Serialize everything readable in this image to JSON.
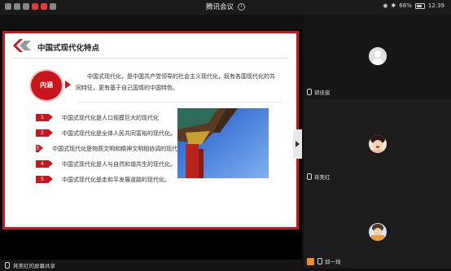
{
  "statusbar": {
    "title": "腾讯会议",
    "battery": "66%",
    "time": "12:39"
  },
  "slide": {
    "title": "中国式现代化特点",
    "neihan_label": "内涵",
    "neihan_text": "中国式现代化，是中国共产党领导的社会主义现代化，既有各国现代化的共同特征，更有基于自己国情的中国特色。",
    "points": [
      {
        "num": "1",
        "text": "中国式现代化是人口规模巨大的现代化"
      },
      {
        "num": "2",
        "text": "中国式现代化是全体人民共同富裕的现代化。"
      },
      {
        "num": "3",
        "text": "中国式现代化是物质文明和精神文明相协调的现代化。"
      },
      {
        "num": "4",
        "text": "中国式现代化是人与自然和谐共生的现代化。"
      },
      {
        "num": "5",
        "text": "中国式现代化是走和平发展道路的现代化。"
      }
    ]
  },
  "share_footer": "蒋美红的屏幕共享",
  "participants": [
    {
      "name": "郭佳宸"
    },
    {
      "name": "蒋美红"
    },
    {
      "name": "邱一琦"
    }
  ],
  "colors": {
    "accent_red": "#c9151e",
    "orange": "#f08a24"
  }
}
